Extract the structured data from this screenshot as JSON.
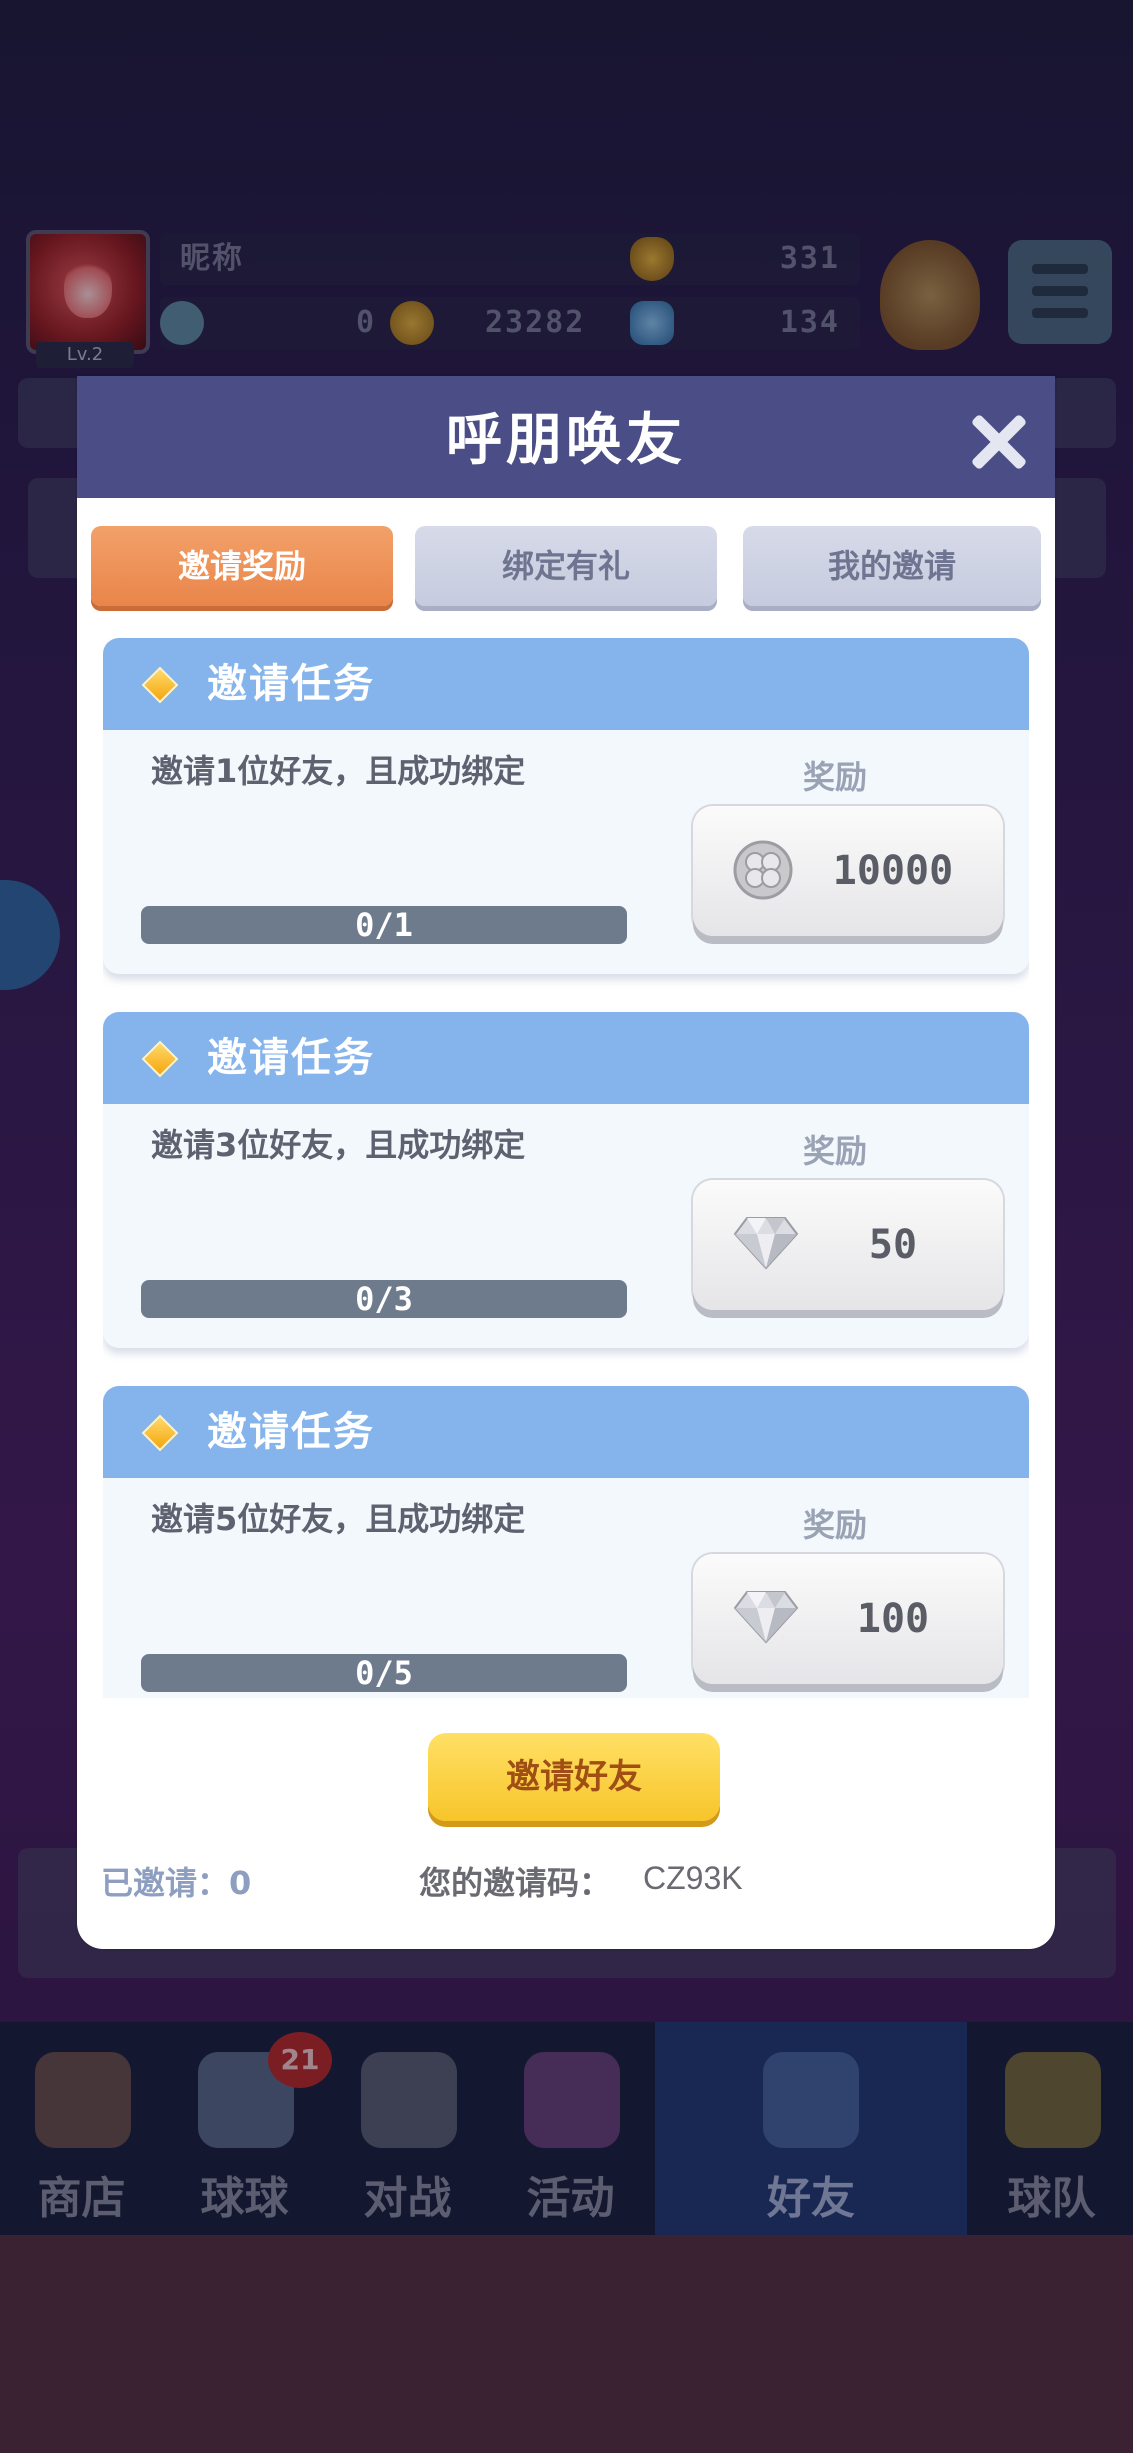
{
  "hud": {
    "nickname": "昵称",
    "level": "Lv.2",
    "trophies": "331",
    "stat_a": "0",
    "coins": "23282",
    "gems": "134"
  },
  "modal": {
    "title": "呼朋唤友",
    "tabs": [
      {
        "label": "邀请奖励",
        "active": true
      },
      {
        "label": "绑定有礼",
        "active": false
      },
      {
        "label": "我的邀请",
        "active": false
      }
    ],
    "tasks": [
      {
        "title": "邀请任务",
        "desc": "邀请1位好友，且成功绑定",
        "reward_label": "奖励",
        "progress": "0/1",
        "reward_icon": "clover-coin-icon",
        "reward_value": "10000"
      },
      {
        "title": "邀请任务",
        "desc": "邀请3位好友，且成功绑定",
        "reward_label": "奖励",
        "progress": "0/3",
        "reward_icon": "diamond-icon",
        "reward_value": "50"
      },
      {
        "title": "邀请任务",
        "desc": "邀请5位好友，且成功绑定",
        "reward_label": "奖励",
        "progress": "0/5",
        "reward_icon": "diamond-icon",
        "reward_value": "100"
      }
    ],
    "invite_button": "邀请好友",
    "invited_count": "已邀请：0",
    "code_label": "您的邀请码：",
    "code_value": "CZ93K"
  },
  "bottom_nav": {
    "items": [
      {
        "label": "商店",
        "icon": "shop-icon"
      },
      {
        "label": "球球",
        "icon": "ball-icon",
        "badge": "21"
      },
      {
        "label": "对战",
        "icon": "crossed-swords-icon"
      },
      {
        "label": "活动",
        "icon": "party-popper-icon"
      },
      {
        "label": "好友",
        "icon": "friends-icon",
        "active": true
      },
      {
        "label": "球队",
        "icon": "whistle-icon"
      }
    ]
  },
  "colors": {
    "modal_header": "#4b4e86",
    "active_tab": "#e9854a",
    "task_header": "#85b4ec",
    "invite_button": "#f7c52a"
  }
}
